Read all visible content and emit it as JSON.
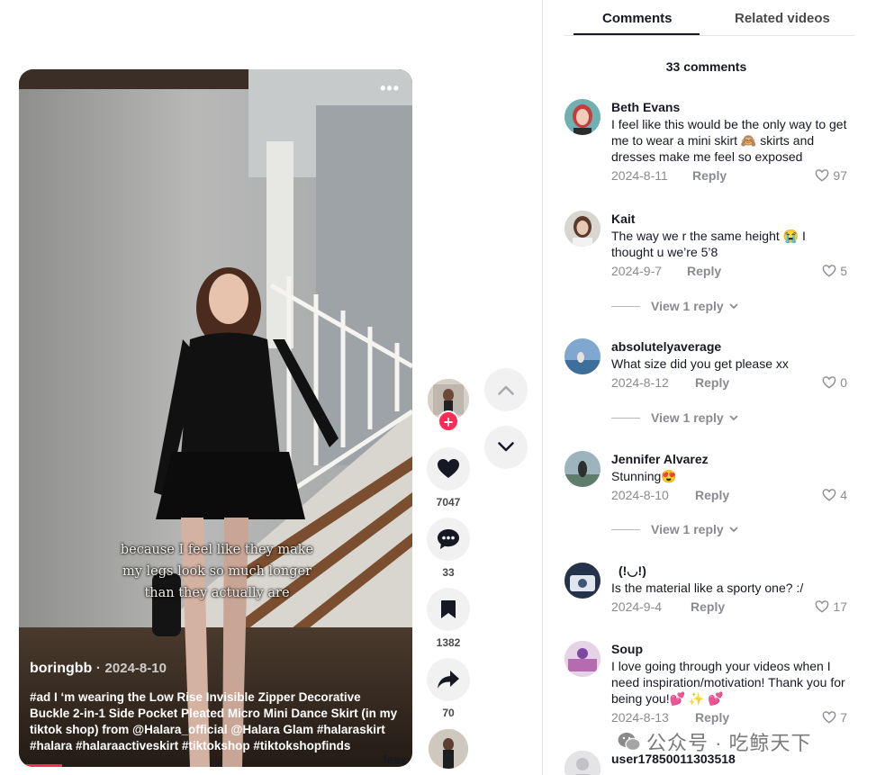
{
  "video": {
    "more_label": "•••",
    "overlay_lines": [
      "because I feel like they make",
      "my legs look so much longer",
      "than they actually are"
    ],
    "author": "boringbb",
    "date": "2024-8-10",
    "description": "#ad  I ‘m wearing the Low Rise Invisible Zipper Decorative Buckle 2-in-1 Side Pocket Pleated Micro Mini Dance Skirt (in my tiktok shop) from @Halara_official  @Halara Glam  #halaraskirt #halara  #halaraactiveskirt  #tiktokshop  #tiktokshopfinds",
    "less_label": "less",
    "progress_fraction": 0.11
  },
  "actions": {
    "follow_symbol": "+",
    "likes": "7047",
    "comments": "33",
    "saves": "1382",
    "shares": "70"
  },
  "tabs": {
    "comments": "Comments",
    "related": "Related videos"
  },
  "comment_count": "33 comments",
  "reply_label": "Reply",
  "comments": [
    {
      "name": "Beth Evans",
      "text": "I feel like this would be the only way to get me to wear a mini skirt 🙈 skirts and dresses make me feel so exposed",
      "date": "2024-8-11",
      "likes": "97",
      "view_replies": ""
    },
    {
      "name": "Kait",
      "text": "The way we r the same height 😭 I thought u we’re 5’8",
      "date": "2024-9-7",
      "likes": "5",
      "view_replies": "View 1 reply"
    },
    {
      "name": "absolutelyaverage",
      "text": "What size did you get please xx",
      "date": "2024-8-12",
      "likes": "0",
      "view_replies": "View 1 reply"
    },
    {
      "name": "Jennifer Alvarez",
      "text": "Stunning😍",
      "date": "2024-8-10",
      "likes": "4",
      "view_replies": "View 1 reply"
    },
    {
      "name": "(!◡!)",
      "text": "Is the material like a sporty one? :/",
      "date": "2024-9-4",
      "likes": "17",
      "view_replies": ""
    },
    {
      "name": "Soup",
      "text": "I love going through your videos when I need inspiration/motivation! Thank you for being you!💕 ✨ 💕",
      "date": "2024-8-13",
      "likes": "7",
      "view_replies": ""
    },
    {
      "name": "user17850011303518",
      "text": "",
      "date": "",
      "likes": "",
      "view_replies": ""
    }
  ],
  "watermark": {
    "text": "公众号 · 吃鲸天下"
  },
  "colors": {
    "accent": "#fe2c55",
    "text": "#161823",
    "muted": "#8a8b91"
  }
}
